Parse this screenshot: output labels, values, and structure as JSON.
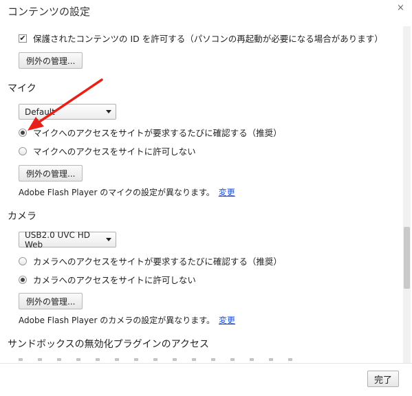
{
  "dialog": {
    "title": "コンテンツの設定",
    "close_label": "×"
  },
  "protected_content": {
    "checkbox_label": "保護されたコンテンツの ID を許可する（パソコンの再起動が必要になる場合があります）",
    "checked": true,
    "exceptions_button": "例外の管理..."
  },
  "mic": {
    "title": "マイク",
    "device_select": "Default",
    "options": [
      {
        "label": "マイクへのアクセスをサイトが要求するたびに確認する（推奨）",
        "checked": true
      },
      {
        "label": "マイクへのアクセスをサイトに許可しない",
        "checked": false
      }
    ],
    "exceptions_button": "例外の管理...",
    "flash_note": "Adobe Flash Player のマイクの設定が異なります。",
    "change_link": "変更"
  },
  "camera": {
    "title": "カメラ",
    "device_select": "USB2.0 UVC HD Web",
    "options": [
      {
        "label": "カメラへのアクセスをサイトが要求するたびに確認する（推奨）",
        "checked": false
      },
      {
        "label": "カメラへのアクセスをサイトに許可しない",
        "checked": true
      }
    ],
    "exceptions_button": "例外の管理...",
    "flash_note": "Adobe Flash Player のカメラの設定が異なります。",
    "change_link": "変更"
  },
  "sandbox": {
    "title": "サンドボックスの無効化プラグインのアクセス"
  },
  "footer": {
    "done_button": "完了"
  },
  "colors": {
    "annotation_arrow": "#e8201a",
    "link": "#1a4dd8"
  }
}
